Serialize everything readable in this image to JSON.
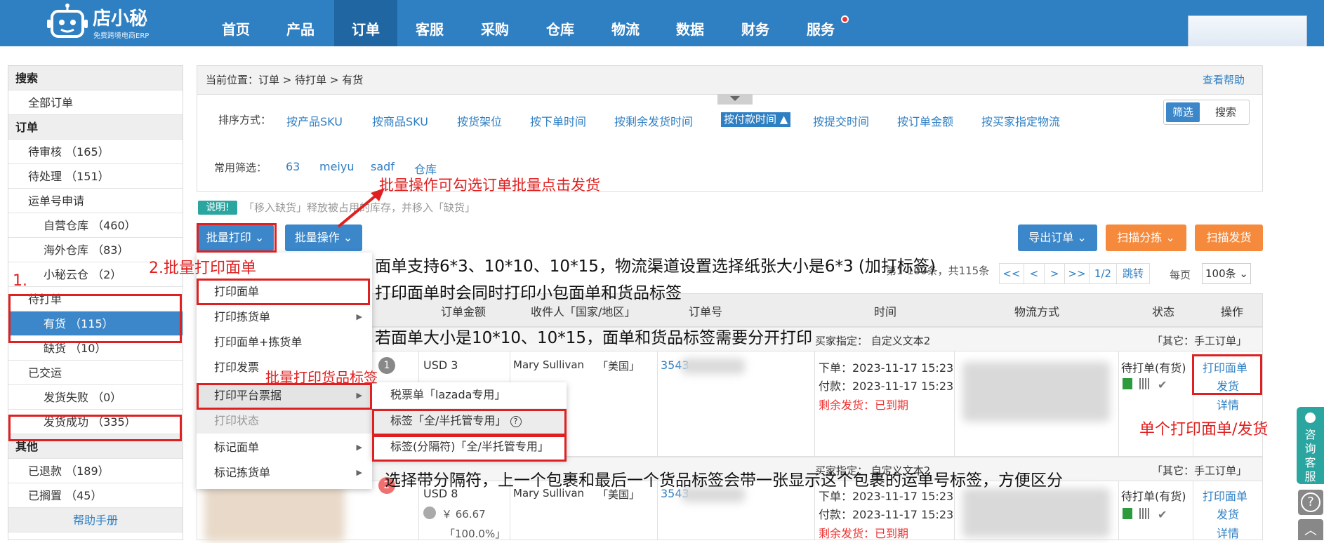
{
  "nav": {
    "logo_text": "店小秘",
    "logo_sub": "免费跨境电商ERP",
    "items": [
      "首页",
      "产品",
      "订单",
      "客服",
      "采购",
      "仓库",
      "物流",
      "数据",
      "财务",
      "服务"
    ]
  },
  "sidebar": {
    "search_head": "搜索",
    "all_orders": "全部订单",
    "orders_head": "订单",
    "pending_review": "待审核 （165）",
    "pending_process": "待处理 （151）",
    "waybill_apply": "运单号申请",
    "self_warehouse": "自营仓库 （460）",
    "overseas_warehouse": "海外仓库 （83）",
    "cloud_warehouse": "小秘云仓 （2）",
    "to_print": "待打单",
    "in_stock": "有货 （115）",
    "out_of_stock": "缺货 （10）",
    "shipped": "已交运",
    "ship_failed": "发货失败 （0）",
    "ship_success": "发货成功 （335）",
    "other_head": "其他",
    "refunded": "已退款 （189）",
    "shelved": "已搁置 （45）",
    "help": "帮助手册"
  },
  "breadcrumb": {
    "label": "当前位置：",
    "path": "订单 > 待打单 > 有货",
    "help": "查看帮助"
  },
  "sort": {
    "label": "排序方式：",
    "options": [
      "按产品SKU",
      "按商品SKU",
      "按货架位",
      "按下单时间",
      "按剩余发货时间",
      "按付款时间",
      "按提交时间",
      "按订单金额",
      "按买家指定物流"
    ],
    "active_label": "按付款时间 ▲"
  },
  "common_filter": {
    "label": "常用筛选：",
    "items": [
      "63",
      "meiyu",
      "sadf",
      "仓库"
    ]
  },
  "toggle": {
    "filter": "筛选",
    "search": "搜索"
  },
  "note": {
    "badge": "说明!",
    "text": "「移入缺货」释放被占用的库存，并移入「缺货」"
  },
  "buttons": {
    "batch_print": "批量打印 ⌄",
    "batch_op": "批量操作 ⌄",
    "export": "导出订单 ⌄",
    "scan_sort": "扫描分拣 ⌄",
    "scan_ship": "扫描发货"
  },
  "pager": {
    "summary": "第1-100条，共115条",
    "first": "<<",
    "prev": "<",
    "next": ">",
    "last": ">>",
    "page": "1/2",
    "jump": "跳转",
    "per_page_label": "每页",
    "per_page": "100条 ⌄"
  },
  "table_head": [
    "订单金额",
    "收件人「国家/地区」",
    "订单号",
    "时间",
    "物流方式",
    "状态",
    "操作"
  ],
  "orders": [
    {
      "index": "1",
      "buyer_note": "买家指定：  自定义文本2",
      "other": "「其它：手工订单」",
      "amount": "USD 3",
      "recipient": "Mary Sullivan",
      "country": "「美国」",
      "order_no": "3543",
      "ordered": "下单：2023-11-17 15:23",
      "paid": "付款：2023-11-17 15:23",
      "remaining": "剩余发货：已到期",
      "status": "待打单(有货)",
      "action_print": "打印面单",
      "action_ship": "发货",
      "action_detail": "详情"
    },
    {
      "index": "2",
      "buyer_note": "买家指定：  自定义文本2",
      "other": "「其它：手工订单」",
      "amount": "USD 8",
      "cost": "￥ 66.67",
      "profit": "「100.0%」",
      "recipient": "Mary Sullivan",
      "country": "「美国」",
      "order_no": "3543",
      "ordered": "下单：2023-11-17 15:23",
      "paid": "付款：2023-11-17 15:23",
      "remaining": "剩余发货：已到期",
      "status": "待打单(有货)",
      "action_print": "打印面单",
      "action_ship": "发货",
      "action_detail": "详情"
    }
  ],
  "dropdown": {
    "items": [
      "打印面单",
      "打印拣货单",
      "打印面单+拣货单",
      "打印发票",
      "打印平台票据",
      "打印状态",
      "标记面单",
      "标记拣货单"
    ]
  },
  "submenu": {
    "items": [
      "税票单「lazada专用」",
      "标签「全/半托管专用」",
      "标签(分隔符)「全/半托管专用」"
    ]
  },
  "annotations": {
    "a1": "1.",
    "a2": "2.批量打印面单",
    "a_batch": "批量操作可勾选订单批量点击发货",
    "a_size1": "面单支持6*3、10*10、10*15，物流渠道设置选择纸张大小是6*3 (加打标签)",
    "a_size2": "打印面单时会同时打印小包面单和货品标签",
    "a_size3": "若面单大小是10*10、10*15，面单和货品标签需要分开打印",
    "a_goods": "批量打印货品标签",
    "a_single": "单个打印面单/发货",
    "a_sep": "选择带分隔符，上一个包裹和最后一个货品标签会带一张显示这个包裹的运单号标签，方便区分"
  },
  "consult": "咨询客服",
  "colors": {
    "primary": "#2f7fc3",
    "orange": "#f58a3c",
    "annotation": "#e02020",
    "teal": "#2aa5a0"
  }
}
